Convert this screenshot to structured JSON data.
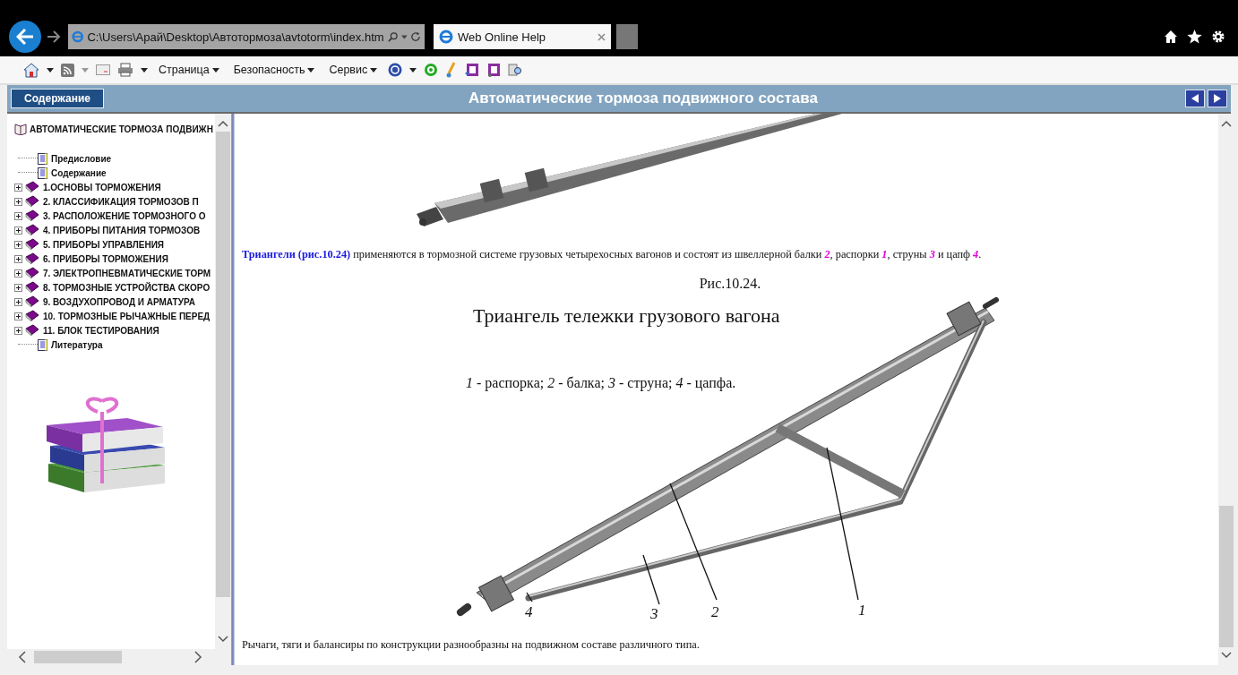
{
  "browser": {
    "address": "C:\\Users\\Арай\\Desktop\\Автотормоза\\avtotorm\\index.htm",
    "tabs": [
      {
        "title": "Web Online Help",
        "selected": true
      }
    ]
  },
  "command_bar": {
    "menus": [
      "Страница",
      "Безопасность",
      "Сервис"
    ]
  },
  "header": {
    "contents_button": "Содержание",
    "title": "Автоматические тормоза подвижного состава"
  },
  "tree": {
    "root": "АВТОМАТИЧЕСКИЕ ТОРМОЗА ПОДВИЖН",
    "items": [
      {
        "kind": "page",
        "label": "Предисловие"
      },
      {
        "kind": "page",
        "label": "Содержание"
      },
      {
        "kind": "book",
        "label": "1.ОСНОВЫ ТОРМОЖЕНИЯ",
        "expanded": false
      },
      {
        "kind": "book",
        "label": "2. КЛАССИФИКАЦИЯ ТОРМОЗОВ П",
        "expanded": false
      },
      {
        "kind": "book",
        "label": "3. РАСПОЛОЖЕНИЕ ТОРМОЗНОГО О",
        "expanded": false
      },
      {
        "kind": "book",
        "label": "4. ПРИБОРЫ ПИТАНИЯ ТОРМОЗОВ",
        "expanded": false
      },
      {
        "kind": "book",
        "label": "5. ПРИБОРЫ УПРАВЛЕНИЯ",
        "expanded": false
      },
      {
        "kind": "book",
        "label": "6. ПРИБОРЫ ТОРМОЖЕНИЯ",
        "expanded": false
      },
      {
        "kind": "book",
        "label": "7. ЭЛЕКТРОПНЕВМАТИЧЕСКИЕ ТОРМ",
        "expanded": false
      },
      {
        "kind": "book",
        "label": "8. ТОРМОЗНЫЕ УСТРОЙСТВА СКОРО",
        "expanded": false
      },
      {
        "kind": "book",
        "label": "9. ВОЗДУХОПРОВОД И АРМАТУРА",
        "expanded": false
      },
      {
        "kind": "book",
        "label": "10. ТОРМОЗНЫЕ РЫЧАЖНЫЕ ПЕРЕД",
        "expanded": false
      },
      {
        "kind": "book",
        "label": "11. БЛОК ТЕСТИРОВАНИЯ",
        "expanded": false
      },
      {
        "kind": "page",
        "label": "Литература"
      }
    ]
  },
  "article": {
    "intro": "**Триангели (рис.10.24)** применяются в тормозной системе грузовых четырехосных вагонов и состоят из швеллерной балки *2*, распорки *1*, струны *3* и цапф *4*.",
    "caption": "Рис.10.24.",
    "figure": {
      "title": "Триангель тележки грузового вагона",
      "legend": "*1* - распорка; *2* - балка; *3* - струна; *4* - цапфа.",
      "callouts": [
        "4",
        "3",
        "2",
        "1"
      ]
    },
    "outro": "Рычаги, тяги и балансиры по конструкции разнообразны на подвижном составе различного типа."
  }
}
